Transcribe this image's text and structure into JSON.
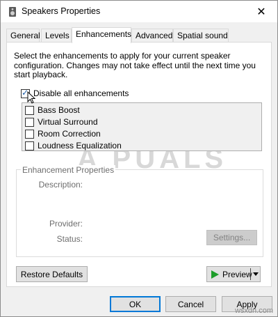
{
  "window": {
    "title": "Speakers Properties",
    "close_glyph": "✕"
  },
  "tabs": [
    {
      "label": "General"
    },
    {
      "label": "Levels"
    },
    {
      "label": "Enhancements",
      "active": true
    },
    {
      "label": "Advanced"
    },
    {
      "label": "Spatial sound"
    }
  ],
  "enhancements": {
    "description": "Select the enhancements to apply for your current speaker configuration. Changes may not take effect until the next time you start playback.",
    "disable_all": {
      "label": "Disable all enhancements",
      "checked": true
    },
    "items": [
      {
        "label": "Bass Boost",
        "checked": false
      },
      {
        "label": "Virtual Surround",
        "checked": false
      },
      {
        "label": "Room Correction",
        "checked": false
      },
      {
        "label": "Loudness Equalization",
        "checked": false
      }
    ]
  },
  "properties": {
    "group_label": "Enhancement Properties",
    "description_label": "Description:",
    "provider_label": "Provider:",
    "status_label": "Status:",
    "settings_button": "Settings..."
  },
  "buttons": {
    "restore_defaults": "Restore Defaults",
    "preview": "Preview",
    "ok": "OK",
    "cancel": "Cancel",
    "apply": "Apply"
  },
  "watermark": {
    "text": "A PUALS",
    "site": "wsxdn.com"
  },
  "colors": {
    "accent": "#0078d7",
    "play": "#1e9d2b"
  }
}
